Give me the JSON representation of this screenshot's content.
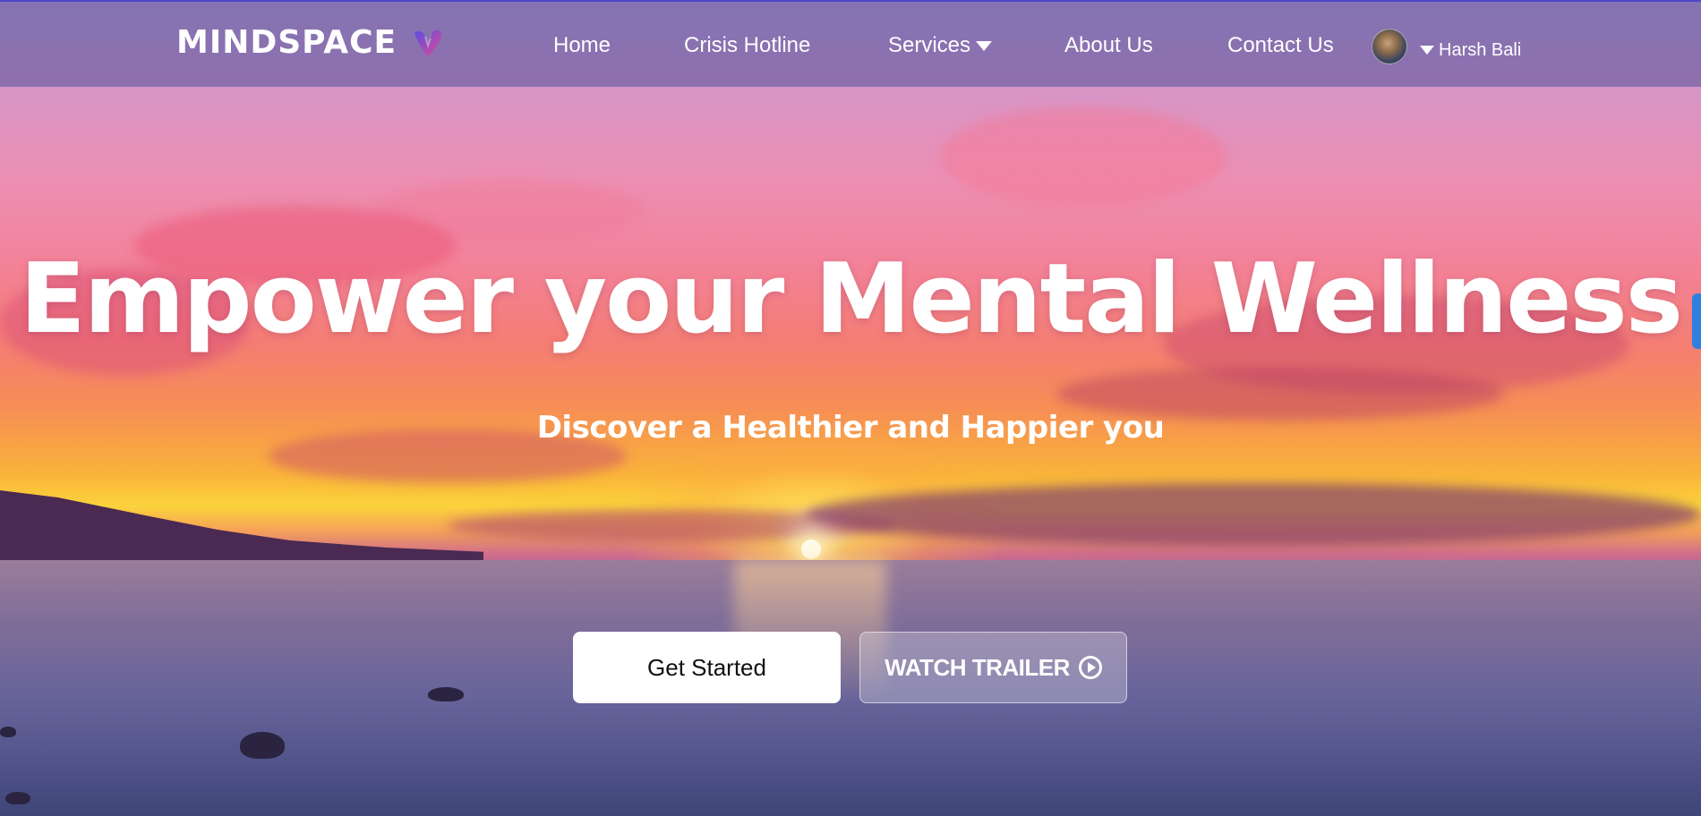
{
  "brand": {
    "name": "MINDSPACE",
    "logo_icon": "heart-v-logo-icon"
  },
  "nav": {
    "home": "Home",
    "crisis": "Crisis Hotline",
    "services": "Services",
    "about": "About Us",
    "contact": "Contact Us"
  },
  "user": {
    "name": "Harsh Bali",
    "avatar_icon": "user-avatar"
  },
  "hero": {
    "headline": "Empower your Mental Wellness",
    "subheadline": "Discover a Healthier and Happier you"
  },
  "actions": {
    "primary": "Get Started",
    "secondary": "WATCH TRAILER",
    "secondary_icon": "play-circle-icon"
  },
  "colors": {
    "navbar_bg": "#6458a0",
    "accent_scroll": "#2f7fe0",
    "logo_gradient_start": "#5a4ee0",
    "logo_gradient_end": "#e04a9a"
  }
}
